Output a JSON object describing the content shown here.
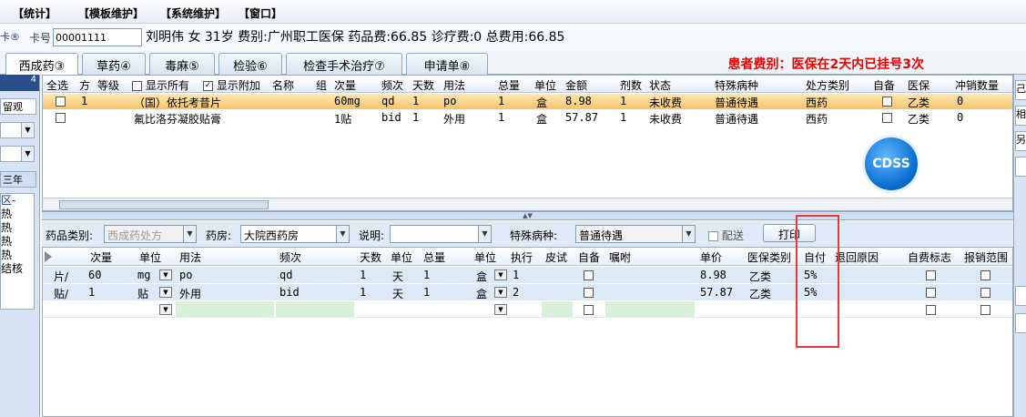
{
  "menu": [
    "【统计】",
    "【模板维护】",
    "【系统维护】",
    "【窗口】"
  ],
  "patient": {
    "card_button": "卡®",
    "card_label": "卡号",
    "card_number": "00001111",
    "info": "刘明伟 女 31岁 费别:广州职工医保 药品费:66.85 诊疗费:0 总费用:66.85"
  },
  "tabs": [
    {
      "label": "西成药③",
      "active": true
    },
    {
      "label": "草药④",
      "active": false
    },
    {
      "label": "毒麻⑤",
      "active": false
    },
    {
      "label": "检验⑥",
      "active": false
    },
    {
      "label": "检查手术治疗⑦",
      "active": false
    },
    {
      "label": "申请单⑧",
      "active": false
    }
  ],
  "alert": "患者费别：医保在2天内已挂号3次",
  "left_panel": {
    "head": "4",
    "items": [
      "留观",
      "三年"
    ],
    "list": [
      "区-",
      "热",
      "热",
      "热",
      "热",
      "结核"
    ]
  },
  "right_panel": [
    "己",
    "相",
    "另",
    "",
    "",
    ""
  ],
  "upper_grid": {
    "options": {
      "show_all": "显示所有",
      "show_extra": "显示附加"
    },
    "headers": [
      "全选",
      "方",
      "等级",
      "名称",
      "组",
      "次量",
      "频次",
      "天数",
      "用法",
      "总量",
      "单位",
      "金额",
      "剂数",
      "状态",
      "特殊病种",
      "处方类别",
      "自备",
      "医保",
      "冲销数量"
    ],
    "rows": [
      {
        "fang": "1",
        "name": "（国）依托考昔片",
        "dose": "60mg",
        "freq": "qd",
        "days": "1",
        "usage": "po",
        "total": "1",
        "unit": "盒",
        "amount": "8.98",
        "doses": "1",
        "status": "未收费",
        "disease": "普通待遇",
        "category": "西药",
        "insurance": "乙类",
        "cancel": "0",
        "selected": true
      },
      {
        "fang": "",
        "name": "氟比洛芬凝胶贴膏",
        "dose": "1贴",
        "freq": "bid",
        "days": "1",
        "usage": "外用",
        "total": "1",
        "unit": "盒",
        "amount": "57.87",
        "doses": "1",
        "status": "未收费",
        "disease": "普通待遇",
        "category": "西药",
        "insurance": "乙类",
        "cancel": "0",
        "selected": false
      }
    ],
    "cdss": "CDSS"
  },
  "toolbar": {
    "drug_category_label": "药品类别:",
    "drug_category_value": "西成药处方",
    "pharmacy_label": "药房:",
    "pharmacy_value": "大院西药房",
    "note_label": "说明:",
    "note_value": "",
    "special_label": "特殊病种:",
    "special_value": "普通待遇",
    "delivery_label": "配送",
    "print_label": "打印"
  },
  "lower_grid": {
    "headers": [
      "次量",
      "单位",
      "用法",
      "频次",
      "天数",
      "单位",
      "总量",
      "单位",
      "执行",
      "皮试",
      "自备",
      "嘱咐",
      "单价",
      "医保类别",
      "自付",
      "退回原因",
      "自费标志",
      "报销范围"
    ],
    "rows": [
      {
        "prefix": "片/",
        "dose": "60",
        "dose_unit": "mg",
        "usage": "po",
        "freq": "qd",
        "days": "1",
        "days_unit": "天",
        "total": "1",
        "total_unit": "盒",
        "exec": "1",
        "price": "8.98",
        "ins_type": "乙类",
        "self_pay": "5%"
      },
      {
        "prefix": "贴/",
        "dose": "1",
        "dose_unit": "贴",
        "usage": "外用",
        "freq": "bid",
        "days": "1",
        "days_unit": "天",
        "total": "1",
        "total_unit": "盒",
        "exec": "2",
        "price": "57.87",
        "ins_type": "乙类",
        "self_pay": "5%"
      }
    ]
  }
}
